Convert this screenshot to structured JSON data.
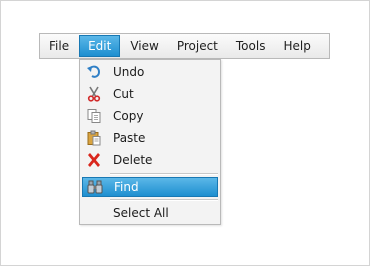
{
  "menubar": {
    "items": [
      {
        "label": "File"
      },
      {
        "label": "Edit"
      },
      {
        "label": "View"
      },
      {
        "label": "Project"
      },
      {
        "label": "Tools"
      },
      {
        "label": "Help"
      }
    ],
    "active_item": "Edit"
  },
  "edit_menu": {
    "items": [
      {
        "label": "Undo",
        "icon": "undo-icon"
      },
      {
        "label": "Cut",
        "icon": "scissors-icon"
      },
      {
        "label": "Copy",
        "icon": "copy-icon"
      },
      {
        "label": "Paste",
        "icon": "paste-icon"
      },
      {
        "label": "Delete",
        "icon": "delete-x-icon"
      },
      {
        "label": "Find",
        "icon": "binoculars-icon",
        "highlighted": true
      },
      {
        "label": "Select All",
        "icon": ""
      }
    ]
  },
  "colors": {
    "highlight_top": "#5bb7e8",
    "highlight_bottom": "#1e8fd0",
    "delete_icon": "#d9261c",
    "undo_icon": "#2f7fc6",
    "scissors_icon": "#d12a2a"
  }
}
